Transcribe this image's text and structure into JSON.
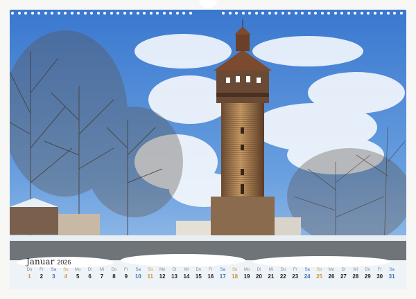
{
  "calendar": {
    "month": "Januar",
    "year": "2026",
    "days": [
      {
        "n": "Do",
        "d": "1",
        "t": "hol"
      },
      {
        "n": "Fr",
        "d": "2",
        "t": ""
      },
      {
        "n": "Sa",
        "d": "3",
        "t": "sat"
      },
      {
        "n": "So",
        "d": "4",
        "t": "sun"
      },
      {
        "n": "Mo",
        "d": "5",
        "t": ""
      },
      {
        "n": "Di",
        "d": "6",
        "t": ""
      },
      {
        "n": "Mi",
        "d": "7",
        "t": ""
      },
      {
        "n": "Do",
        "d": "8",
        "t": ""
      },
      {
        "n": "Fr",
        "d": "9",
        "t": ""
      },
      {
        "n": "Sa",
        "d": "10",
        "t": "sat"
      },
      {
        "n": "So",
        "d": "11",
        "t": "sun"
      },
      {
        "n": "Mo",
        "d": "12",
        "t": ""
      },
      {
        "n": "Di",
        "d": "13",
        "t": ""
      },
      {
        "n": "Mi",
        "d": "14",
        "t": ""
      },
      {
        "n": "Do",
        "d": "15",
        "t": ""
      },
      {
        "n": "Fr",
        "d": "16",
        "t": ""
      },
      {
        "n": "Sa",
        "d": "17",
        "t": "sat"
      },
      {
        "n": "So",
        "d": "18",
        "t": "sun"
      },
      {
        "n": "Mo",
        "d": "19",
        "t": ""
      },
      {
        "n": "Di",
        "d": "20",
        "t": ""
      },
      {
        "n": "Mi",
        "d": "21",
        "t": ""
      },
      {
        "n": "Do",
        "d": "22",
        "t": ""
      },
      {
        "n": "Fr",
        "d": "23",
        "t": ""
      },
      {
        "n": "Sa",
        "d": "24",
        "t": "sat"
      },
      {
        "n": "So",
        "d": "25",
        "t": "sun"
      },
      {
        "n": "Mo",
        "d": "26",
        "t": ""
      },
      {
        "n": "Di",
        "d": "27",
        "t": ""
      },
      {
        "n": "Mi",
        "d": "28",
        "t": ""
      },
      {
        "n": "Do",
        "d": "29",
        "t": ""
      },
      {
        "n": "Fr",
        "d": "30",
        "t": ""
      },
      {
        "n": "Sa",
        "d": "31",
        "t": "sat"
      }
    ]
  },
  "colors": {
    "saturday": "#3b6fb5",
    "sunday": "#c9963a",
    "sky": "#3f7fd0"
  }
}
